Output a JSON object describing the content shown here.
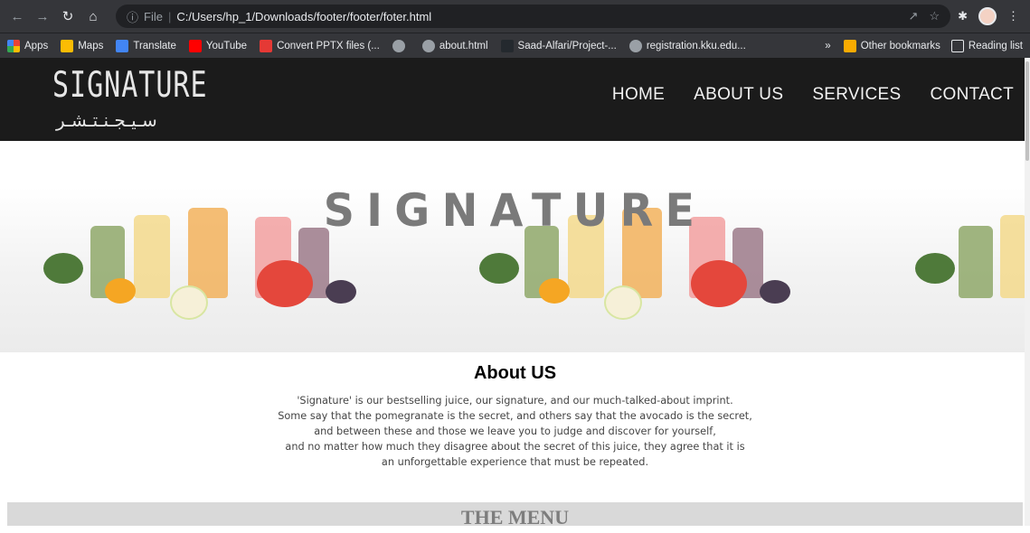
{
  "browser": {
    "scheme": "File",
    "url": "C:/Users/hp_1/Downloads/footer/footer/foter.html"
  },
  "bookmarks": [
    {
      "label": "Apps",
      "icon": "apps-grid-icon",
      "color": "#ea4335"
    },
    {
      "label": "Maps",
      "icon": "maps-pin-icon",
      "color": "#fbbc04"
    },
    {
      "label": "Translate",
      "icon": "translate-icon",
      "color": "#4285f4"
    },
    {
      "label": "YouTube",
      "icon": "youtube-icon",
      "color": "#ff0000"
    },
    {
      "label": "Convert PPTX files (...",
      "icon": "pdf-icon",
      "color": "#e53935"
    },
    {
      "label": "",
      "icon": "globe-icon",
      "color": "#9aa0a6"
    },
    {
      "label": "about.html",
      "icon": "globe-icon",
      "color": "#9aa0a6"
    },
    {
      "label": "Saad-Alfari/Project-...",
      "icon": "github-icon",
      "color": "#24292e"
    },
    {
      "label": "registration.kku.edu...",
      "icon": "globe-icon",
      "color": "#9aa0a6"
    }
  ],
  "bookmarks_right": {
    "overflow": "»",
    "other": "Other bookmarks",
    "reading": "Reading list"
  },
  "site": {
    "logo_latin": "SIGNATURE",
    "logo_arabic": "سـيـجـنـتـشـر",
    "nav": [
      "HOME",
      "ABOUT US",
      "SERVICES",
      "CONTACT"
    ]
  },
  "hero": {
    "title": "SIGNATURE"
  },
  "about": {
    "heading": "About US",
    "lines": [
      "'Signature' is our bestselling juice, our signature, and our much-talked-about imprint.",
      "Some say that the pomegranate is the secret, and others say that the avocado is the secret,",
      "and between these and those we leave you to judge and discover for yourself,",
      "and no matter how much they disagree about the secret of this juice, they agree that it is",
      "an unforgettable experience that must be repeated."
    ]
  },
  "menu": {
    "title": "THE MENU"
  },
  "colors": {
    "header_bg": "#1b1b1b",
    "hero_title": "#7a7a7a",
    "band": "#d9d9d9"
  }
}
